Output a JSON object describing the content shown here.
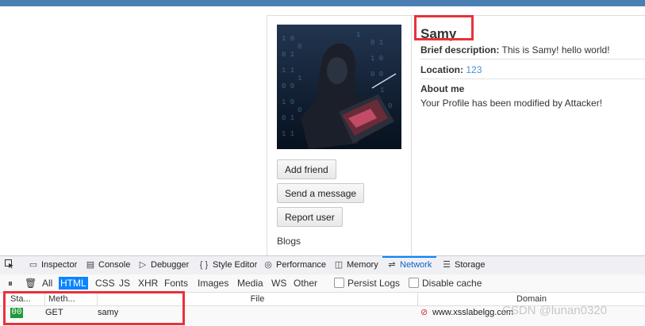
{
  "profile": {
    "name": "Samy",
    "brief_label": "Brief description:",
    "brief_value": "This is Samy! hello world!",
    "location_label": "Location:",
    "location_value": "123",
    "about_label": "About me",
    "about_value": "Your Profile has been modified by Attacker!",
    "buttons": {
      "add_friend": "Add friend",
      "send_message": "Send a message",
      "report_user": "Report user"
    },
    "blogs_label": "Blogs"
  },
  "devtools": {
    "tabs": {
      "inspector": "Inspector",
      "console": "Console",
      "debugger": "Debugger",
      "style_editor": "Style Editor",
      "performance": "Performance",
      "memory": "Memory",
      "network": "Network",
      "storage": "Storage"
    },
    "filters": {
      "all": "All",
      "html": "HTML",
      "css": "CSS",
      "js": "JS",
      "xhr": "XHR",
      "fonts": "Fonts",
      "images": "Images",
      "media": "Media",
      "ws": "WS",
      "other": "Other"
    },
    "persist_logs": "Persist Logs",
    "disable_cache": "Disable cache",
    "columns": {
      "status": "Sta...",
      "method": "Meth...",
      "file": "File",
      "domain": "Domain"
    },
    "request": {
      "status": "00",
      "method": "GET",
      "file": "samy",
      "domain": "www.xsslabelgg.com"
    }
  },
  "watermark": "CSDN @lunan0320",
  "colors": {
    "highlight": "#e8323a",
    "accent": "#0a84ff",
    "status_ok": "#1e9a38",
    "link": "#4690d6"
  }
}
